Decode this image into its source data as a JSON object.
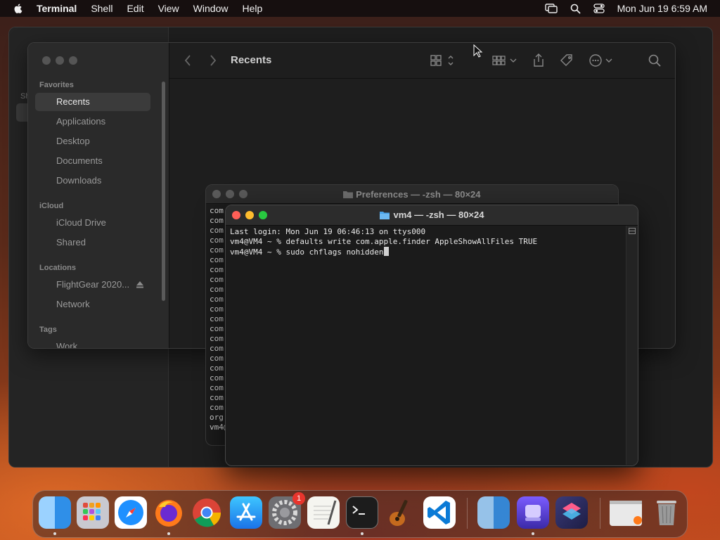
{
  "menubar": {
    "app": "Terminal",
    "items": [
      "Shell",
      "Edit",
      "View",
      "Window",
      "Help"
    ],
    "clock": "Mon Jun 19  6:59 AM",
    "status_icons": [
      "screen-mirroring-icon",
      "search-icon",
      "control-center-icon"
    ]
  },
  "finder_back": {
    "side_header": "Sh"
  },
  "finder": {
    "title": "Recents",
    "sections": [
      {
        "header": "Favorites",
        "items": [
          "Recents",
          "Applications",
          "Desktop",
          "Documents",
          "Downloads"
        ]
      },
      {
        "header": "iCloud",
        "items": [
          "iCloud Drive",
          "Shared"
        ]
      },
      {
        "header": "Locations",
        "items": [
          "FlightGear 2020...",
          "Network"
        ]
      },
      {
        "header": "Tags",
        "items": [
          "Work"
        ]
      }
    ]
  },
  "term_back": {
    "title": "Preferences — -zsh — 80×24",
    "lines": [
      "com",
      "com",
      "com",
      "com",
      "com",
      "com",
      "com",
      "com",
      "com",
      "com",
      "com",
      "com",
      "com",
      "com",
      "com",
      "com",
      "com",
      "com",
      "com",
      "com",
      "com",
      "org",
      "vm4@"
    ]
  },
  "terminal": {
    "title": "vm4 — -zsh — 80×24",
    "line1": "Last login: Mon Jun 19 06:46:13 on ttys000",
    "line2": "vm4@VM4 ~ % defaults write com.apple.finder AppleShowAllFiles TRUE",
    "line3": "vm4@VM4 ~ % sudo chflags nohidden"
  },
  "dock": {
    "apps": [
      "Finder",
      "Launchpad",
      "Safari",
      "Firefox",
      "Chrome",
      "App Store",
      "System Settings",
      "TextEdit",
      "Terminal",
      "GarageBand",
      "Visual Studio Code",
      "Preview",
      "Xcode",
      "Shortcuts",
      "Window Preview",
      "Trash"
    ],
    "settings_badge": "1"
  },
  "colors": {
    "close": "#ff5f57",
    "minimize": "#febc2e",
    "zoom": "#28c840",
    "folder": "#4aa3e8"
  }
}
